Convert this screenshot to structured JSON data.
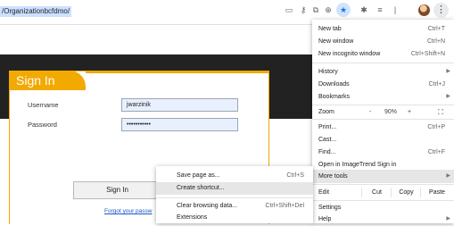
{
  "browser": {
    "url": "/Organizationbcfdmo/",
    "icons": [
      "screencast-icon",
      "key-icon",
      "share-icon",
      "zoom-icon",
      "bookmark-star-icon",
      "extensions-icon",
      "reading-list-icon",
      "avatar",
      "menu-icon"
    ]
  },
  "signin": {
    "title": "Sign In",
    "username_label": "Username",
    "username_value": "jwarzinik",
    "password_label": "Password",
    "password_value": "•••••••••••",
    "button": "Sign In",
    "forgot": "Forgot your passw"
  },
  "menu": {
    "new_tab": "New tab",
    "new_tab_key": "Ctrl+T",
    "new_window": "New window",
    "new_window_key": "Ctrl+N",
    "new_incognito": "New incognito window",
    "new_incognito_key": "Ctrl+Shift+N",
    "history": "History",
    "downloads": "Downloads",
    "downloads_key": "Ctrl+J",
    "bookmarks": "Bookmarks",
    "zoom": "Zoom",
    "zoom_minus": "-",
    "zoom_value": "90%",
    "zoom_plus": "+",
    "print": "Print...",
    "print_key": "Ctrl+P",
    "cast": "Cast...",
    "find": "Find...",
    "find_key": "Ctrl+F",
    "open_in": "Open in ImageTrend Sign in",
    "more_tools": "More tools",
    "edit": "Edit",
    "cut": "Cut",
    "copy": "Copy",
    "paste": "Paste",
    "settings": "Settings",
    "help": "Help"
  },
  "submenu": {
    "save_page": "Save page as...",
    "save_page_key": "Ctrl+S",
    "create_shortcut": "Create shortcut...",
    "clear_browsing": "Clear browsing data...",
    "clear_browsing_key": "Ctrl+Shift+Del",
    "extensions": "Extensions"
  },
  "colors": {
    "accent": "#f2a900",
    "url_highlight": "#cce0ff",
    "dark_band": "#222222"
  }
}
